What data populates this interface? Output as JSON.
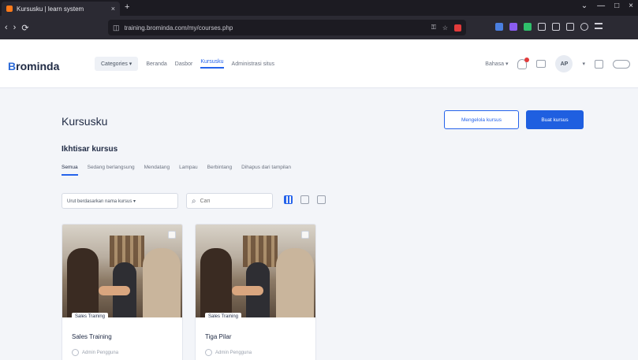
{
  "browser": {
    "tab_title": "Kursusku | learn system",
    "tab_close": "×",
    "new_tab": "+",
    "window_controls": [
      "⌄",
      "—",
      "□",
      "×"
    ],
    "nav_buttons": [
      "‹",
      "›",
      "⟳"
    ],
    "url": "training.brominda.com/my/courses.php"
  },
  "header": {
    "logo_mark": "B",
    "logo_text": "rominda",
    "menu": {
      "category_label": "Categories ▾",
      "items": [
        "Beranda",
        "Dasbor",
        "Kursusku",
        "Administrasi situs"
      ]
    },
    "lang_label": "Bahasa ▾",
    "avatar_initials": "AP",
    "avatar_chevron": "▾"
  },
  "main": {
    "page_title": "Kursusku",
    "manage_button": "Mengelola kursus",
    "new_button": "Buat kursus",
    "section_title": "Ikhtisar kursus",
    "filters": [
      "Semua",
      "Sedang berlangsung",
      "Mendatang",
      "Lampau",
      "Berbintang",
      "Dihapus dari tampilan"
    ],
    "sort_label": "Urut berdasarkan nama kursus ▾",
    "search_placeholder": "Cari"
  },
  "courses": [
    {
      "category": "Sales Training",
      "name": "Sales Training",
      "progress_label": "Admin Pengguna"
    },
    {
      "category": "Sales Training",
      "name": "Tiga Pilar",
      "progress_label": "Admin Pengguna"
    }
  ]
}
